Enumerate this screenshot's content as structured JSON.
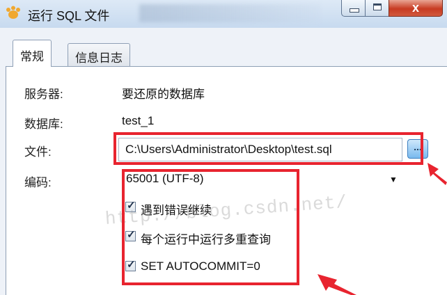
{
  "window": {
    "title": "运行 SQL 文件",
    "close_glyph": "x"
  },
  "tabs": [
    {
      "label": "常规",
      "active": true
    },
    {
      "label": "信息日志",
      "active": false
    }
  ],
  "form": {
    "server_label": "服务器:",
    "server_value": "要还原的数据库",
    "database_label": "数据库:",
    "database_value": "test_1",
    "file_label": "文件:",
    "file_value": "C:\\Users\\Administrator\\Desktop\\test.sql",
    "browse_label": "...",
    "encoding_label": "编码:",
    "encoding_value": "65001 (UTF-8)"
  },
  "options": [
    {
      "label": "遇到错误继续",
      "checked": true
    },
    {
      "label": "每个运行中运行多重查询",
      "checked": true
    },
    {
      "label": "SET AUTOCOMMIT=0",
      "checked": true
    }
  ],
  "watermark": "http://blog.csdn.net/",
  "colors": {
    "annotation": "#e8242f",
    "browse_button": "#79b9ee"
  }
}
